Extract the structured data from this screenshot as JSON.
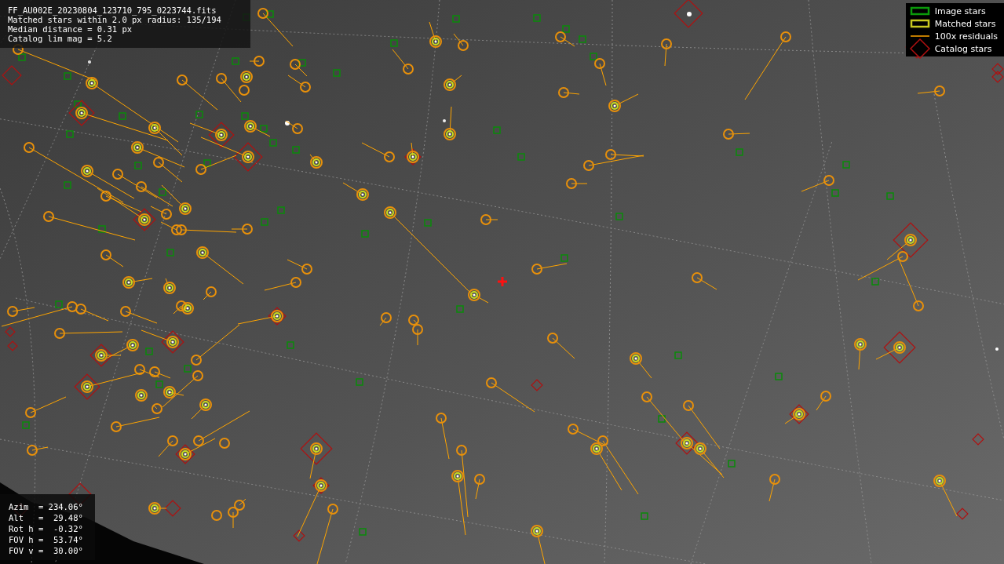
{
  "info_panel": {
    "lines": [
      "FF_AU002E_20230804_123710_795_0223744.fits",
      "Matched stars within 2.0 px radius: 135/194",
      "Median distance = 0.31 px",
      "Catalog lim mag = 5.2"
    ]
  },
  "legend": {
    "items": [
      {
        "label": "Image stars"
      },
      {
        "kind": "matched",
        "label": "Matched stars"
      },
      {
        "kind": "residual",
        "label": "100x residuals"
      },
      {
        "kind": "catalog",
        "label": "Catalog stars"
      }
    ]
  },
  "pointing": {
    "lines": [
      "Azim  = 234.06°",
      "Alt   =  29.48°",
      "Rot h =  -0.32°",
      "FOV h =  53.74°",
      "FOV v =  30.00°"
    ]
  }
}
